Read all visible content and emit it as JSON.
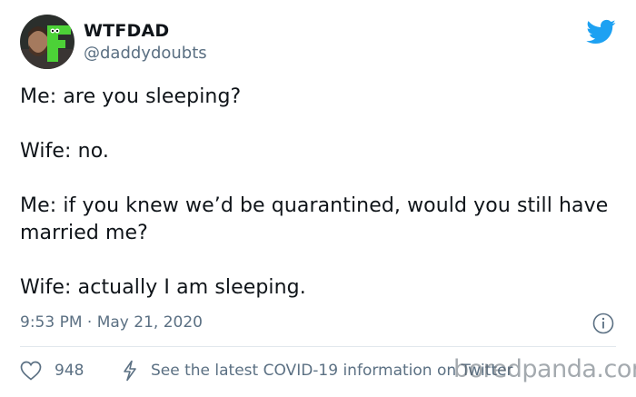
{
  "author": {
    "display_name": "WTFDAD",
    "handle": "@daddydoubts"
  },
  "tweet": {
    "text": "Me: are you sleeping?\n\nWife: no.\n\nMe: if you knew we’d be quarantined, would you still have married me?\n\nWife: actually I am sleeping.",
    "timestamp": "9:53 PM · May 21, 2020"
  },
  "footer": {
    "like_count": "948",
    "covid_link": "See the latest COVID-19 information on Twitter"
  },
  "watermark": "boredpanda.com",
  "icons": {
    "brand": "twitter-bird-icon",
    "info": "info-icon",
    "like": "heart-icon",
    "covid": "lightning-icon"
  },
  "colors": {
    "twitter_blue": "#1da1f2",
    "secondary_text": "#5b7083",
    "avatar_green": "#4cd137"
  }
}
